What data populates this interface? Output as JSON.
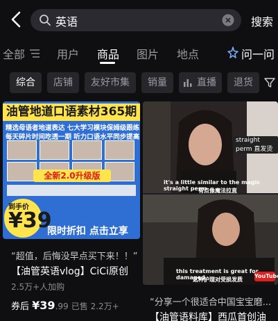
{
  "search": {
    "query": "英语",
    "submit_label": "搜索"
  },
  "tabs": [
    {
      "label": "全部"
    },
    {
      "label": "用户"
    },
    {
      "label": "商品",
      "active": true
    },
    {
      "label": "图片"
    },
    {
      "label": "地点"
    },
    {
      "label": "问一问"
    }
  ],
  "filters": [
    {
      "label": "综合",
      "active": true
    },
    {
      "label": "店铺"
    },
    {
      "label": "友好市集"
    },
    {
      "label": "销量"
    },
    {
      "label": "直播"
    },
    {
      "label": "退货"
    }
  ],
  "products": [
    {
      "promo_title": "油管地道口语素材365期",
      "promo_line1": "精选母语者地道表达 七大学习模块保姆级跟练",
      "promo_line2": "每天碎片时间吃透一期 听力口语水平同步提高",
      "promo_badge": "全新2.0升级版",
      "promo_price_label": "到手价",
      "promo_price": "¥39",
      "promo_cta": "限时折扣 点击立享",
      "quote": "“超值，后悔没早点买下来！！”",
      "title": "【油管英语vlog】CiCi原创",
      "subtitle": "2.5万+人加购",
      "coupon_label": "券后",
      "price_main": "¥39",
      "price_decimal": ".99",
      "sold": "已售 2.2万+"
    },
    {
      "subtitle_top_en": "it's a little similar to the magic straight perm",
      "subtitle_top_zh": "有点像魔法拉直",
      "tag_note": "straight perm 直发烫",
      "subtitle_bottom_en": "this treatment is great for damaged",
      "subtitle_bottom_zh": "这种护理对受损发质",
      "badge": "YouTube",
      "quote": "“分享一个很适合中国宝宝磨...",
      "title": "【油管语料库】西瓜首创油"
    }
  ],
  "colors": {
    "background": "#0f0f12",
    "promo_blue": "#2f6fd4",
    "highlight_yellow": "#ffe44d",
    "accent_red": "#e01a1a"
  }
}
